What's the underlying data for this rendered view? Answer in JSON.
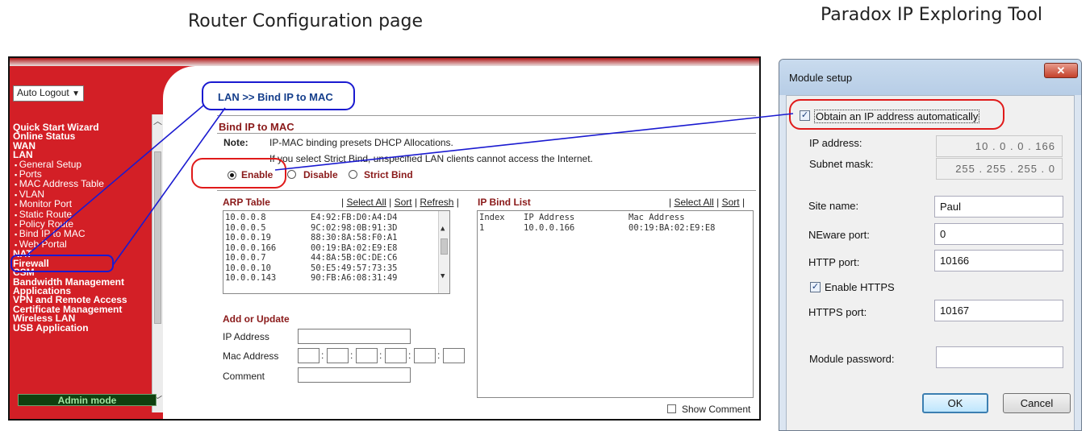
{
  "headings": {
    "router": "Router Configuration page",
    "tool": "Paradox IP Exploring Tool"
  },
  "router": {
    "auto_logout": "Auto Logout",
    "menu": [
      {
        "label": "Quick Start Wizard",
        "type": "main"
      },
      {
        "label": "Online Status",
        "type": "main"
      },
      {
        "label": "WAN",
        "type": "main"
      },
      {
        "label": "LAN",
        "type": "main"
      },
      {
        "label": "General Setup",
        "type": "sub"
      },
      {
        "label": "Ports",
        "type": "sub"
      },
      {
        "label": "MAC Address Table",
        "type": "sub"
      },
      {
        "label": "VLAN",
        "type": "sub"
      },
      {
        "label": "Monitor Port",
        "type": "sub"
      },
      {
        "label": "Static Route",
        "type": "sub"
      },
      {
        "label": "Policy Route",
        "type": "sub"
      },
      {
        "label": "Bind IP to MAC",
        "type": "sub"
      },
      {
        "label": "Web Portal",
        "type": "sub"
      },
      {
        "label": "NAT",
        "type": "main"
      },
      {
        "label": "Firewall",
        "type": "main"
      },
      {
        "label": "CSM",
        "type": "main"
      },
      {
        "label": "Bandwidth Management",
        "type": "main"
      },
      {
        "label": "Applications",
        "type": "main"
      },
      {
        "label": "VPN and Remote Access",
        "type": "main"
      },
      {
        "label": "Certificate Management",
        "type": "main"
      },
      {
        "label": "Wireless LAN",
        "type": "main"
      },
      {
        "label": "USB Application",
        "type": "main"
      }
    ],
    "admin_mode": "Admin mode",
    "breadcrumb": "LAN >> Bind IP to MAC",
    "section_title": "Bind IP to MAC",
    "note_label": "Note:",
    "note_line1": "IP-MAC binding presets DHCP Allocations.",
    "note_line2": "If you select Strict Bind, unspecified LAN clients cannot access the Internet.",
    "mode_options": [
      "Enable",
      "Disable",
      "Strict Bind"
    ],
    "mode_selected": "Enable",
    "arp_title": "ARP Table",
    "arp_links": [
      "Select All",
      "Sort",
      "Refresh"
    ],
    "arp_rows": [
      {
        "ip": "10.0.0.8",
        "mac": "E4:92:FB:D0:A4:D4"
      },
      {
        "ip": "10.0.0.5",
        "mac": "9C:02:98:0B:91:3D"
      },
      {
        "ip": "10.0.0.19",
        "mac": "88:30:8A:58:F0:A1"
      },
      {
        "ip": "10.0.0.166",
        "mac": "00:19:BA:02:E9:E8"
      },
      {
        "ip": "10.0.0.7",
        "mac": "44:8A:5B:0C:DE:C6"
      },
      {
        "ip": "10.0.0.10",
        "mac": "50:E5:49:57:73:35"
      },
      {
        "ip": "10.0.0.143",
        "mac": "90:FB:A6:08:31:49"
      }
    ],
    "bind_title": "IP Bind List",
    "bind_links": [
      "Select All",
      "Sort"
    ],
    "bind_headers": [
      "Index",
      "IP Address",
      "Mac Address"
    ],
    "bind_rows": [
      {
        "index": "1",
        "ip": "10.0.0.166",
        "mac": "00:19:BA:02:E9:E8"
      }
    ],
    "add_title": "Add or Update",
    "field_labels": [
      "IP Address",
      "Mac Address",
      "Comment"
    ],
    "show_comment": "Show Comment"
  },
  "dialog": {
    "title": "Module setup",
    "obtain_ip": "Obtain an IP address automatically",
    "obtain_ip_checked": true,
    "ip_address_label": "IP address:",
    "ip_address": "10 . 0 . 0 . 166",
    "subnet_label": "Subnet mask:",
    "subnet": "255 . 255 . 255 . 0",
    "site_name_label": "Site name:",
    "site_name": "Paul",
    "neware_label": "NEware port:",
    "neware_port": "0",
    "http_label": "HTTP port:",
    "http_port": "10166",
    "enable_https": "Enable HTTPS",
    "enable_https_checked": true,
    "https_label": "HTTPS port:",
    "https_port": "10167",
    "password_label": "Module password:",
    "password": "",
    "ok": "OK",
    "cancel": "Cancel"
  },
  "colors": {
    "sidebar": "#d31f26",
    "callout_blue": "#1a1ad0",
    "callout_red": "#e01a1a",
    "section_title": "#8a1a1a"
  }
}
